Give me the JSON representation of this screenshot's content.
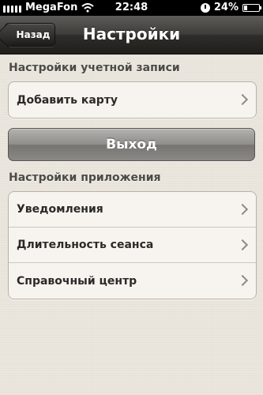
{
  "status_bar": {
    "carrier": "MegaFon",
    "time": "22:48",
    "battery": "24%",
    "battery_level": 0.24,
    "wifi_icon": "wifi-icon",
    "orientation_lock_icon": "orientation-lock-icon"
  },
  "navbar": {
    "back_label": "Назад",
    "title": "Настройки"
  },
  "account_section": {
    "header": "Настройки учетной записи",
    "items": [
      {
        "label": "Добавить карту"
      }
    ]
  },
  "logout": {
    "label": "Выход"
  },
  "app_section": {
    "header": "Настройки приложения",
    "items": [
      {
        "label": "Уведомления"
      },
      {
        "label": "Длительность сеанса"
      },
      {
        "label": "Справочный центр"
      }
    ]
  }
}
